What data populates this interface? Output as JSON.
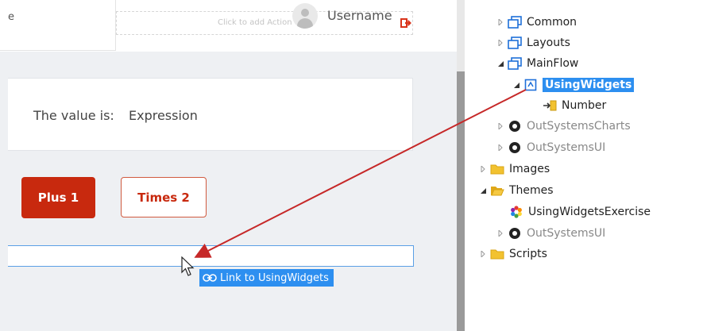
{
  "header": {
    "title_fragment": "e",
    "actions_placeholder": "Click to add Action",
    "username": "Username"
  },
  "main": {
    "value_label": "The value is:",
    "value_expression": "Expression",
    "plus_button": "Plus 1",
    "times_button": "Times 2"
  },
  "drag": {
    "tooltip": "Link to UsingWidgets"
  },
  "tree": {
    "items": [
      {
        "label": "Common"
      },
      {
        "label": "Layouts"
      },
      {
        "label": "MainFlow"
      },
      {
        "label": "UsingWidgets"
      },
      {
        "label": "Number"
      },
      {
        "label": "OutSystemsCharts"
      },
      {
        "label": "OutSystemsUI"
      },
      {
        "label": "Images"
      },
      {
        "label": "Themes"
      },
      {
        "label": "UsingWidgetsExercise"
      },
      {
        "label": "OutSystemsUI"
      },
      {
        "label": "Scripts"
      }
    ]
  },
  "colors": {
    "primary_button": "#c8290e",
    "selection": "#2d8ff0",
    "drag_arrow": "#c62828",
    "folder": "#f2c230",
    "screen_icon": "#1e6fd9"
  }
}
